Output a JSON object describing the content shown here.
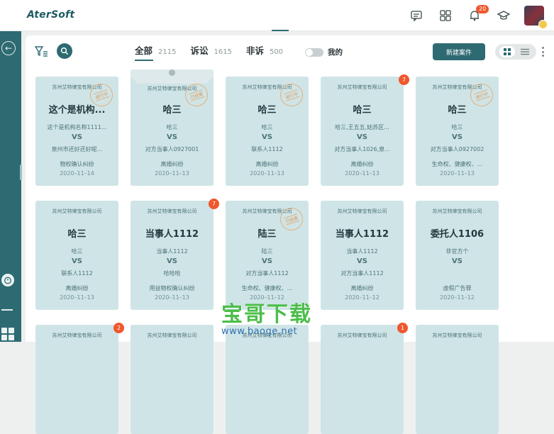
{
  "app": {
    "logo": "AterSoft"
  },
  "topbar": {
    "notifications_badge": "20"
  },
  "toolbar": {
    "tabs": [
      {
        "label": "全部",
        "count": "2115"
      },
      {
        "label": "诉讼",
        "count": "1615"
      },
      {
        "label": "非诉",
        "count": "500"
      }
    ],
    "toggle_label": "我的",
    "new_button": "新建案件"
  },
  "cards": [
    {
      "firm": "苏州艾特律宝有限公司",
      "title": "这个是机构...",
      "party1": "这个是机构名称1111...",
      "party2": "泉州市还好还好呢...",
      "type": "物权确认纠纷",
      "date": "2020–11–14",
      "stamp": "进行中"
    },
    {
      "firm": "苏州艾特律宝有限公司",
      "title": "哈三",
      "party1": "哈三",
      "party2": "对方当事人0927001",
      "type": "离婚纠纷",
      "date": "2020–11–13",
      "stamp": "已结案"
    },
    {
      "firm": "苏州艾特律宝有限公司",
      "title": "哈三",
      "party1": "哈三",
      "party2": "联系人1112",
      "type": "离婚纠纷",
      "date": "2020–11–13",
      "stamp": "进行中"
    },
    {
      "firm": "苏州艾特律宝有限公司",
      "title": "哈三",
      "party1": "哈三,王五五,姑苏区...",
      "party2": "对方当事人1026,泉...",
      "type": "离婚纠纷",
      "date": "2020–11–13",
      "badge": "7"
    },
    {
      "firm": "苏州艾特律宝有限公司",
      "title": "哈三",
      "party1": "哈三",
      "party2": "对方当事人0927002",
      "type": "生命权、健康权、...",
      "date": "2020–11–13",
      "stamp": "进行中"
    },
    {
      "firm": "苏州艾特律宝有限公司",
      "title": "哈三",
      "party1": "哈三",
      "party2": "联系人1112",
      "type": "离婚纠纷",
      "date": "2020–11–13"
    },
    {
      "firm": "苏州艾特律宝有限公司",
      "title": "当事人1112",
      "party1": "当事人1112",
      "party2": "哈哈哈",
      "type": "用益物权确认纠纷",
      "date": "2020–11–13",
      "badge": "7"
    },
    {
      "firm": "苏州艾特律宝有限公司",
      "title": "陆三",
      "party1": "陆三",
      "party2": "对方当事人1112",
      "type": "生命权、健康权、...",
      "date": "2020–11–12",
      "stamp": "已结案"
    },
    {
      "firm": "苏州艾特律宝有限公司",
      "title": "当事人1112",
      "party1": "当事人1112",
      "party2": "对方当事人1112",
      "type": "离婚纠纷",
      "date": "2020–11–12"
    },
    {
      "firm": "苏州艾特律宝有限公司",
      "title": "委托人1106",
      "party1": "非官方个",
      "party2": "",
      "type": "虚假广告罪",
      "date": "2020–11–12"
    },
    {
      "firm": "苏州艾特律宝有限公司",
      "badge": "2"
    },
    {
      "firm": "苏州艾特律宝有限公司"
    },
    {
      "firm": "苏州艾特律宝有限公司"
    },
    {
      "firm": "苏州艾特律宝有限公司",
      "badge": "1"
    },
    {
      "firm": "苏州艾特律宝有限公司"
    }
  ],
  "vs_label": "VS",
  "watermark": {
    "title": "宝哥下载",
    "url": "www.baoge.net"
  },
  "colors": {
    "accent": "#2e6a72",
    "card": "#cfe4e6",
    "badge": "#f0572d"
  }
}
